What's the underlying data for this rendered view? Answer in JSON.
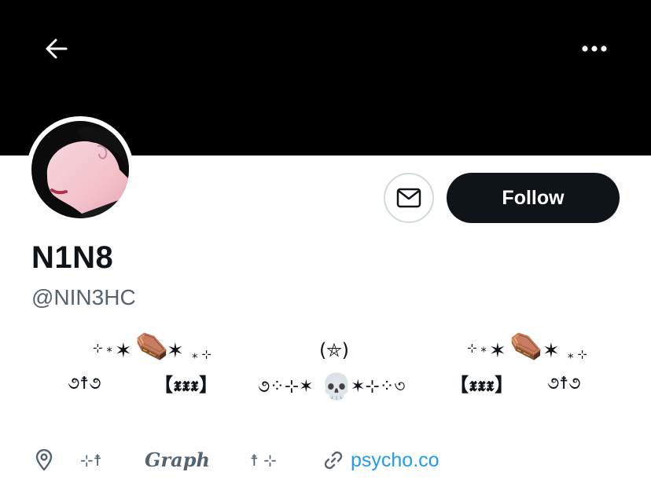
{
  "header": {
    "back_icon": "arrow-left-icon",
    "more_icon": "more-horizontal-icon",
    "banner_color": "#000000"
  },
  "profile": {
    "display_name": "N1N8",
    "handle": "@NIN3HC",
    "follow_label": "Follow",
    "message_icon": "envelope-icon",
    "accent_color": "#0f1419"
  },
  "bio": {
    "left_tag": "【𝖝𝖝𝖝】",
    "right_tag": "【𝖝𝖝𝖝】",
    "center_top": "(⛤)",
    "coffin_emoji": "⚰️",
    "skull_emoji": "💀"
  },
  "meta": {
    "location_icon": "location-pin-icon",
    "location_left": "⊹☨",
    "location_text": "𝑮𝒓𝒂𝒑𝒉",
    "location_right": "☨ ⊹",
    "link_icon": "link-icon",
    "link_text": "psycho.co",
    "link_color": "#1d9bf0"
  }
}
